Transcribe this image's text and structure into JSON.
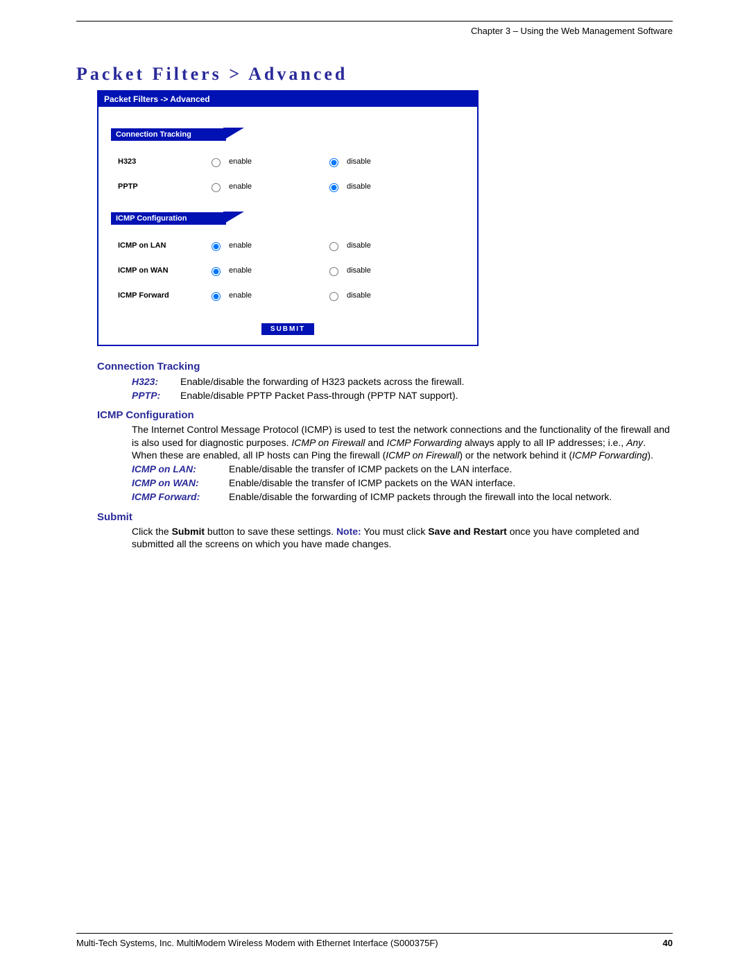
{
  "header": {
    "chapter": "Chapter 3 – Using the Web Management Software"
  },
  "title": "Packet Filters > Advanced",
  "panel": {
    "breadcrumb": "Packet Filters  ->  Advanced",
    "section1": {
      "heading": "Connection Tracking",
      "rows": [
        {
          "label": "H323",
          "opt_enable": "enable",
          "opt_disable": "disable",
          "checked": "disable"
        },
        {
          "label": "PPTP",
          "opt_enable": "enable",
          "opt_disable": "disable",
          "checked": "disable"
        }
      ]
    },
    "section2": {
      "heading": "ICMP Configuration",
      "rows": [
        {
          "label": "ICMP on LAN",
          "opt_enable": "enable",
          "opt_disable": "disable",
          "checked": "enable"
        },
        {
          "label": "ICMP on WAN",
          "opt_enable": "enable",
          "opt_disable": "disable",
          "checked": "enable"
        },
        {
          "label": "ICMP Forward",
          "opt_enable": "enable",
          "opt_disable": "disable",
          "checked": "enable"
        }
      ]
    },
    "submit": "SUBMIT"
  },
  "doc": {
    "ct_heading": "Connection Tracking",
    "ct_items": [
      {
        "term": "H323:",
        "text": "Enable/disable the forwarding of H323 packets across the firewall."
      },
      {
        "term": "PPTP:",
        "text": "Enable/disable PPTP Packet Pass-through (PPTP NAT support)."
      }
    ],
    "icmp_heading": "ICMP Configuration",
    "icmp_intro_1": "The Internet Control Message Protocol (ICMP) is used to test the network connections and the functionality of the firewall and is also used for diagnostic purposes. ",
    "icmp_intro_em1": "ICMP on Firewall",
    "icmp_intro_2": " and ",
    "icmp_intro_em2": "ICMP Forwarding",
    "icmp_intro_3": " always apply to all IP addresses; i.e., ",
    "icmp_intro_em3": "Any",
    "icmp_intro_4": ". When these are enabled, all IP hosts can Ping the firewall (",
    "icmp_intro_em4": "ICMP on Firewall",
    "icmp_intro_5": ") or the network behind it (",
    "icmp_intro_em5": "ICMP Forwarding",
    "icmp_intro_6": ").",
    "icmp_items": [
      {
        "term": "ICMP on LAN:",
        "text": "Enable/disable the transfer of ICMP packets on the LAN interface."
      },
      {
        "term": "ICMP on WAN:",
        "text": "Enable/disable the transfer of ICMP packets on the WAN interface."
      },
      {
        "term": "ICMP Forward:",
        "text": "Enable/disable the forwarding of ICMP packets through the firewall into the local network."
      }
    ],
    "submit_heading": "Submit",
    "submit_1": "Click the ",
    "submit_b1": "Submit",
    "submit_2": " button to save these settings. ",
    "submit_note_lbl": "Note:",
    "submit_3": " You must click ",
    "submit_b2": "Save and Restart",
    "submit_4": " once you have completed and submitted all the screens on which you have made changes."
  },
  "footer": {
    "left": "Multi-Tech Systems, Inc. MultiModem Wireless Modem with Ethernet Interface (S000375F)",
    "right": "40"
  }
}
